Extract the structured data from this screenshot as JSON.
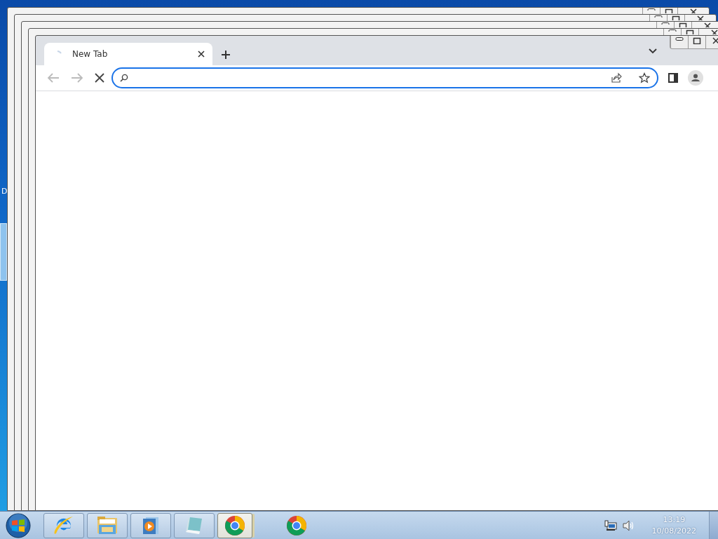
{
  "desktop": {
    "icon_label": "D"
  },
  "browser": {
    "tabs": [
      {
        "title": "New Tab",
        "selected": true
      }
    ],
    "loading": true,
    "address_bar": {
      "focused": true
    }
  },
  "taskbar": {
    "items": [
      {
        "kind": "ie",
        "selected": false
      },
      {
        "kind": "explorer",
        "selected": false
      },
      {
        "kind": "media",
        "selected": false
      },
      {
        "kind": "notepad",
        "selected": false
      },
      {
        "kind": "chrome",
        "selected": true
      },
      {
        "kind": "chrome",
        "selected": false
      }
    ],
    "clock": {
      "time": "13:19",
      "date": "10/08/2022"
    }
  }
}
